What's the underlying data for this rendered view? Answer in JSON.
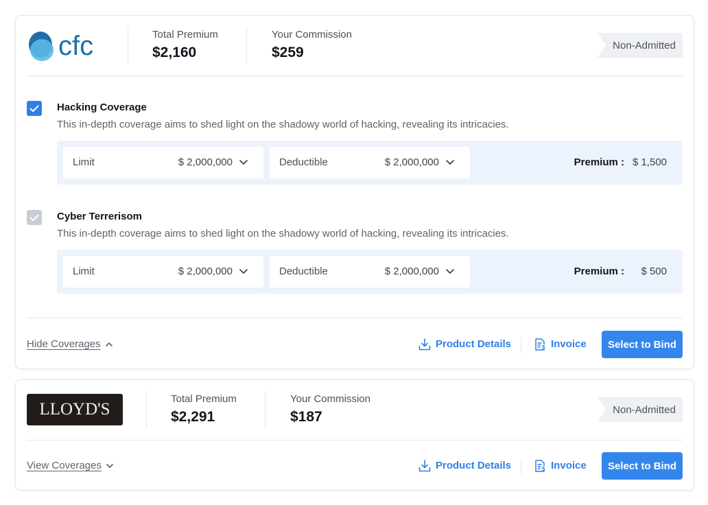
{
  "colors": {
    "accent": "#2f7fe6",
    "button": "#3386ec",
    "panel_bg": "#edf3fc",
    "tag_bg": "#eef0f3"
  },
  "quotes": [
    {
      "logo_text": "cfc",
      "total_premium_label": "Total Premium",
      "total_premium_value": "$2,160",
      "commission_label": "Your Commission",
      "commission_value": "$259",
      "tag": "Non-Admitted",
      "coverages": [
        {
          "checked": true,
          "title": "Hacking Coverage",
          "description": "This in-depth coverage aims to shed light on the shadowy world of hacking, revealing its intricacies.",
          "limit_label": "Limit",
          "limit_value": "$ 2,000,000",
          "deductible_label": "Deductible",
          "deductible_value": "$ 2,000,000",
          "premium_label": "Premium :",
          "premium_value": "$ 1,500"
        },
        {
          "checked": true,
          "disabled": true,
          "title": "Cyber Terrerisom",
          "description": "This in-depth coverage aims to shed light on the shadowy world of hacking, revealing its intricacies.",
          "limit_label": "Limit",
          "limit_value": "$ 2,000,000",
          "deductible_label": "Deductible",
          "deductible_value": "$ 2,000,000",
          "premium_label": "Premium :",
          "premium_value": "$ 500"
        }
      ],
      "toggle_label": "Hide Coverages",
      "product_details_label": "Product Details",
      "invoice_label": "Invoice",
      "bind_label": "Select to Bind"
    },
    {
      "logo_text": "LLOYD'S",
      "total_premium_label": "Total Premium",
      "total_premium_value": "$2,291",
      "commission_label": "Your Commission",
      "commission_value": "$187",
      "tag": "Non-Admitted",
      "toggle_label": "View Coverages",
      "product_details_label": "Product Details",
      "invoice_label": "Invoice",
      "bind_label": "Select to Bind"
    }
  ]
}
